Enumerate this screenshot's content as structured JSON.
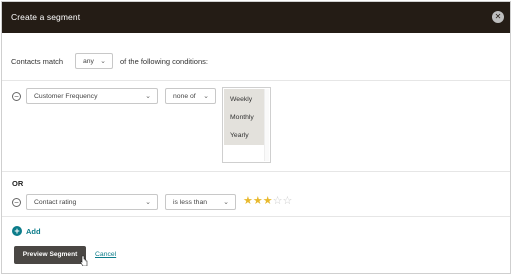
{
  "modal": {
    "title": "Create a segment",
    "close_icon": "close-icon"
  },
  "match": {
    "prefix": "Contacts match",
    "selected": "any",
    "suffix": "of the following conditions:"
  },
  "conditions": [
    {
      "field": "Customer Frequency",
      "operator": "none of",
      "options": [
        "Weekly",
        "Monthly",
        "Yearly"
      ]
    },
    {
      "field": "Contact rating",
      "operator": "is less than",
      "rating": {
        "value": 3,
        "max": 5,
        "on_color": "#e8b92d",
        "off_color": "#c9c9c9"
      }
    }
  ],
  "connector": "OR",
  "add_label": "Add",
  "actions": {
    "preview_label": "Preview Segment",
    "cancel_label": "Cancel"
  },
  "colors": {
    "header_bg": "#241c15",
    "accent": "#0b7c8a",
    "button_bg": "#4a4744"
  }
}
